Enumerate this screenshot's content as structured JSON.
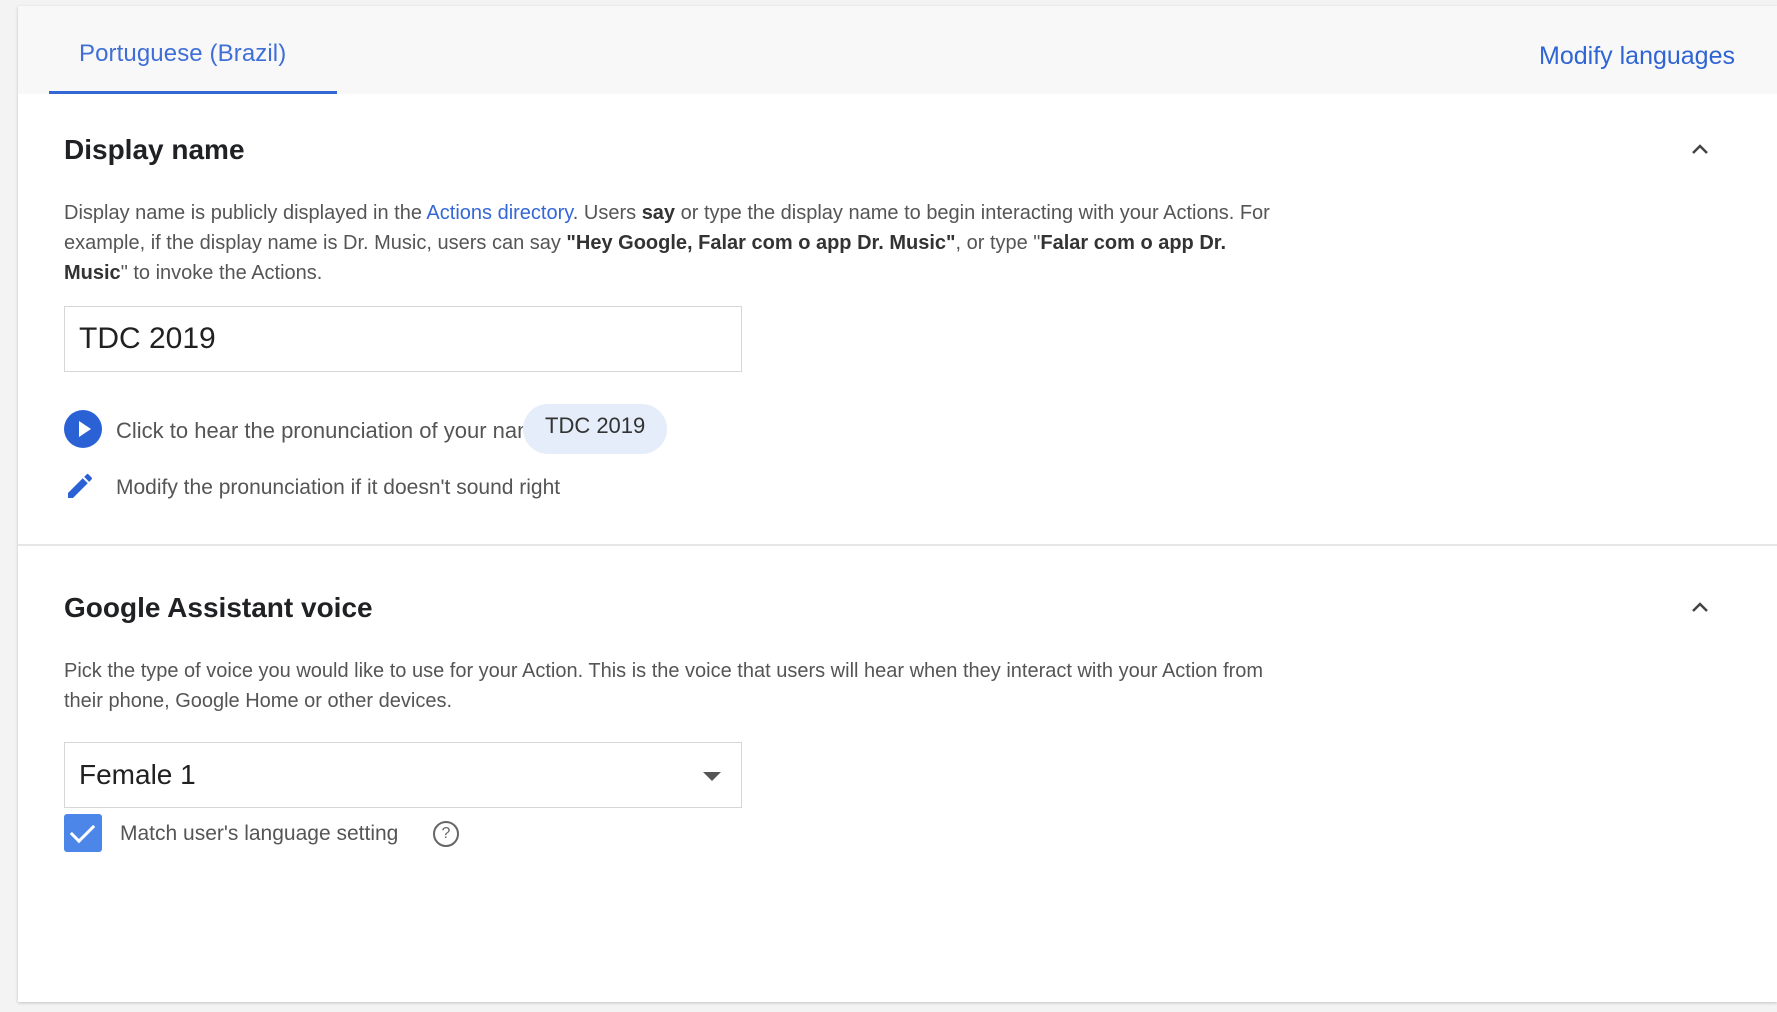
{
  "tabs": {
    "active_label": "Portuguese (Brazil)",
    "modify_languages_label": "Modify languages"
  },
  "display_name": {
    "title": "Display name",
    "description_part1": "Display name is publicly displayed in the ",
    "description_link": "Actions directory",
    "description_part2": ". Users ",
    "description_bold1": "say",
    "description_part3": " or type the display name to begin interacting with your Actions. For example, if the display name is Dr. Music, users can say ",
    "description_bold2": "\"Hey Google, Falar com o app Dr. Music\"",
    "description_part4": ", or type \"",
    "description_bold3": "Falar com o app Dr. Music",
    "description_part5": "\" to invoke the Actions.",
    "value": "TDC 2019",
    "hear_label": "Click to hear the pronunciation of your name",
    "chip_label": "TDC 2019",
    "modify_pronunciation_label": "Modify the pronunciation if it doesn't sound right"
  },
  "assistant_voice": {
    "title": "Google Assistant voice",
    "description": "Pick the type of voice you would like to use for your Action. This is the voice that users will hear when they interact with your Action from their phone, Google Home or other devices.",
    "selected_voice": "Female 1",
    "match_language_label": "Match user's language setting",
    "match_language_checked": true,
    "help_glyph": "?"
  },
  "icons": {
    "collapse": "chevron-up-icon",
    "play": "play-icon",
    "edit": "pencil-icon",
    "dropdown": "dropdown-arrow-icon",
    "help": "help-icon",
    "check": "checkmark-icon"
  },
  "colors": {
    "accent": "#3367d6",
    "chip_bg": "#e4edf9",
    "checkbox": "#4b86e8"
  }
}
